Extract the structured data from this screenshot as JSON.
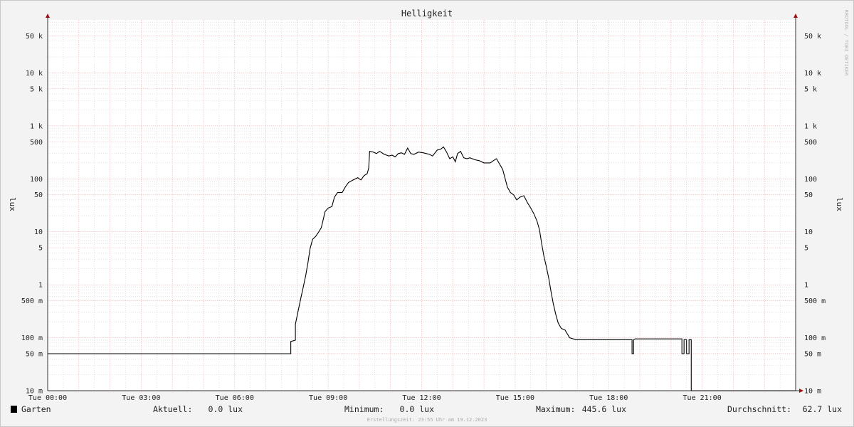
{
  "chart_data": {
    "type": "line",
    "title": "Helligkeit",
    "ylabel": "lux",
    "yscale": "log",
    "ylim": [
      0.01,
      100000
    ],
    "xlim": [
      0,
      24
    ],
    "y_ticks": [
      {
        "v": 50000,
        "label": "50 k"
      },
      {
        "v": 10000,
        "label": "10 k"
      },
      {
        "v": 5000,
        "label": "5 k"
      },
      {
        "v": 1000,
        "label": "1 k"
      },
      {
        "v": 500,
        "label": "500"
      },
      {
        "v": 100,
        "label": "100"
      },
      {
        "v": 50,
        "label": "50"
      },
      {
        "v": 10,
        "label": "10"
      },
      {
        "v": 5,
        "label": "5"
      },
      {
        "v": 1,
        "label": "1"
      },
      {
        "v": 0.5,
        "label": "500 m"
      },
      {
        "v": 0.1,
        "label": "100 m"
      },
      {
        "v": 0.05,
        "label": "50 m"
      },
      {
        "v": 0.01,
        "label": "10 m"
      }
    ],
    "x_ticks": [
      {
        "v": 0,
        "label": "Tue 00:00"
      },
      {
        "v": 3,
        "label": "Tue 03:00"
      },
      {
        "v": 6,
        "label": "Tue 06:00"
      },
      {
        "v": 9,
        "label": "Tue 09:00"
      },
      {
        "v": 12,
        "label": "Tue 12:00"
      },
      {
        "v": 15,
        "label": "Tue 15:00"
      },
      {
        "v": 18,
        "label": "Tue 18:00"
      },
      {
        "v": 21,
        "label": "Tue 21:00"
      }
    ],
    "grid": true,
    "series": [
      {
        "name": "Garten",
        "color": "#000000",
        "points": [
          [
            0,
            0.05
          ],
          [
            7.8,
            0.05
          ],
          [
            7.8,
            0.085
          ],
          [
            7.95,
            0.09
          ],
          [
            7.95,
            0.18
          ],
          [
            8.05,
            0.35
          ],
          [
            8.12,
            0.55
          ],
          [
            8.2,
            0.9
          ],
          [
            8.28,
            1.5
          ],
          [
            8.35,
            2.6
          ],
          [
            8.42,
            4.8
          ],
          [
            8.5,
            7.2
          ],
          [
            8.6,
            8.2
          ],
          [
            8.7,
            10
          ],
          [
            8.78,
            12
          ],
          [
            8.85,
            18
          ],
          [
            8.9,
            24
          ],
          [
            9.0,
            28
          ],
          [
            9.12,
            30
          ],
          [
            9.2,
            45
          ],
          [
            9.3,
            55
          ],
          [
            9.45,
            55
          ],
          [
            9.55,
            70
          ],
          [
            9.65,
            85
          ],
          [
            9.8,
            95
          ],
          [
            9.95,
            105
          ],
          [
            10.05,
            95
          ],
          [
            10.15,
            115
          ],
          [
            10.25,
            125
          ],
          [
            10.3,
            160
          ],
          [
            10.33,
            330
          ],
          [
            10.45,
            320
          ],
          [
            10.55,
            300
          ],
          [
            10.65,
            330
          ],
          [
            10.8,
            290
          ],
          [
            10.95,
            270
          ],
          [
            11.05,
            280
          ],
          [
            11.15,
            260
          ],
          [
            11.25,
            300
          ],
          [
            11.35,
            310
          ],
          [
            11.45,
            290
          ],
          [
            11.55,
            380
          ],
          [
            11.65,
            300
          ],
          [
            11.75,
            290
          ],
          [
            11.9,
            320
          ],
          [
            12.05,
            310
          ],
          [
            12.25,
            290
          ],
          [
            12.35,
            270
          ],
          [
            12.5,
            350
          ],
          [
            12.6,
            360
          ],
          [
            12.7,
            400
          ],
          [
            12.8,
            320
          ],
          [
            12.9,
            240
          ],
          [
            13.0,
            260
          ],
          [
            13.08,
            210
          ],
          [
            13.15,
            300
          ],
          [
            13.25,
            330
          ],
          [
            13.35,
            250
          ],
          [
            13.45,
            240
          ],
          [
            13.55,
            250
          ],
          [
            13.7,
            230
          ],
          [
            13.85,
            220
          ],
          [
            14.0,
            200
          ],
          [
            14.2,
            200
          ],
          [
            14.3,
            220
          ],
          [
            14.4,
            240
          ],
          [
            14.5,
            190
          ],
          [
            14.6,
            150
          ],
          [
            14.68,
            100
          ],
          [
            14.75,
            70
          ],
          [
            14.85,
            55
          ],
          [
            14.95,
            50
          ],
          [
            15.05,
            40
          ],
          [
            15.15,
            45
          ],
          [
            15.28,
            48
          ],
          [
            15.4,
            35
          ],
          [
            15.5,
            28
          ],
          [
            15.6,
            22
          ],
          [
            15.7,
            16
          ],
          [
            15.78,
            11
          ],
          [
            15.85,
            6
          ],
          [
            15.92,
            3.5
          ],
          [
            16.0,
            2.2
          ],
          [
            16.08,
            1.3
          ],
          [
            16.15,
            0.75
          ],
          [
            16.22,
            0.45
          ],
          [
            16.3,
            0.28
          ],
          [
            16.38,
            0.19
          ],
          [
            16.48,
            0.15
          ],
          [
            16.6,
            0.14
          ],
          [
            16.75,
            0.1
          ],
          [
            16.95,
            0.092
          ],
          [
            18.75,
            0.092
          ],
          [
            18.75,
            0.05
          ],
          [
            18.8,
            0.05
          ],
          [
            18.8,
            0.092
          ],
          [
            18.85,
            0.095
          ],
          [
            20.35,
            0.095
          ],
          [
            20.35,
            0.05
          ],
          [
            20.42,
            0.05
          ],
          [
            20.42,
            0.092
          ],
          [
            20.5,
            0.092
          ],
          [
            20.5,
            0.05
          ],
          [
            20.58,
            0.05
          ],
          [
            20.58,
            0.092
          ],
          [
            20.65,
            0.092
          ],
          [
            20.65,
            0.01
          ],
          [
            24,
            0.01
          ]
        ]
      }
    ]
  },
  "legend": {
    "swatch_color": "#000000",
    "series_label": "Garten",
    "stats": [
      {
        "label": "Aktuell:",
        "value": "0.0 lux"
      },
      {
        "label": "Minimum:",
        "value": "0.0 lux"
      },
      {
        "label": "Maximum:",
        "value": "445.6 lux"
      },
      {
        "label": "Durchschnitt:",
        "value": "62.7 lux"
      }
    ]
  },
  "footer": "Erstellungszeit: 23:55 Uhr am 19.12.2023",
  "watermark": "RRDTOOL / TOBI OETIKER"
}
